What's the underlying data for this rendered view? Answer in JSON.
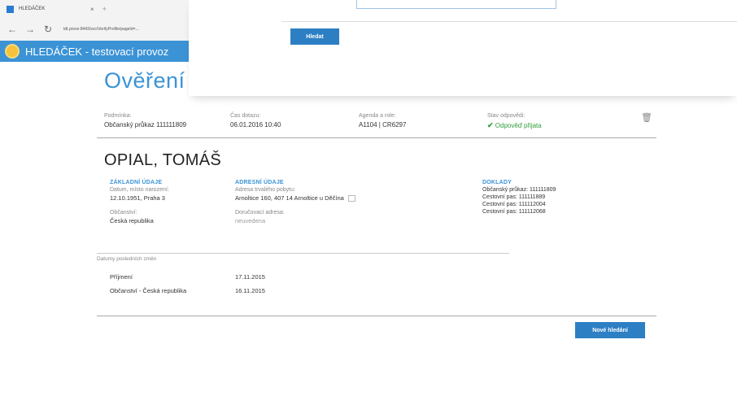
{
  "browser": {
    "tab_title": "HLEDÁČEK",
    "tab_close": "×",
    "tab_new": "+",
    "back": "←",
    "forward": "→",
    "refresh": "↻",
    "url": "tdt.prove:8443/svc/VerifyProfile/pageId=..."
  },
  "app": {
    "title": "HLEDÁČEK - testovací provoz"
  },
  "search": {
    "button_label": "Hledat"
  },
  "page": {
    "title": "Ověření"
  },
  "query": {
    "condition_label": "Podmínka:",
    "condition_value": "Občanský průkaz 111111809",
    "time_label": "Čas dotazu:",
    "time_value": "06.01.2016 10:40",
    "agenda_label": "Agenda a role:",
    "agenda_value": "A1104 | CR6297",
    "status_label": "Stav odpovědi:",
    "status_icon": "✔",
    "status_value": "Odpověď přijata",
    "trash_icon": "🗑"
  },
  "person": {
    "name": "OPIAL, TOMÁŠ"
  },
  "basic": {
    "title": "ZÁKLADNÍ ÚDAJE",
    "birth_label": "Datum, místo narození:",
    "birth_value": "12.10.1951, Praha 3",
    "citizenship_label": "Občanství:",
    "citizenship_value": "Česká republika"
  },
  "address": {
    "title": "ADRESNÍ ÚDAJE",
    "residence_label": "Adresa trvalého pobytu:",
    "residence_value": "Arnoltice 160, 407 14 Arnoltice u Děčína",
    "delivery_label": "Doručovací adresa:",
    "delivery_value": "neuvedena"
  },
  "documents": {
    "title": "DOKLADY",
    "items": [
      "Občanský průkaz: 111111809",
      "Cestovní pas: 111111889",
      "Cestovní pas: 111112004",
      "Cestovní pas: 111112068"
    ]
  },
  "changes": {
    "label": "Datumy posledních změn",
    "rows": [
      {
        "name": "Příjmení",
        "date": "17.11.2015"
      },
      {
        "name": "Občanství - Česká republika",
        "date": "16.11.2015"
      }
    ]
  },
  "actions": {
    "new_search": "Nové hledání"
  }
}
